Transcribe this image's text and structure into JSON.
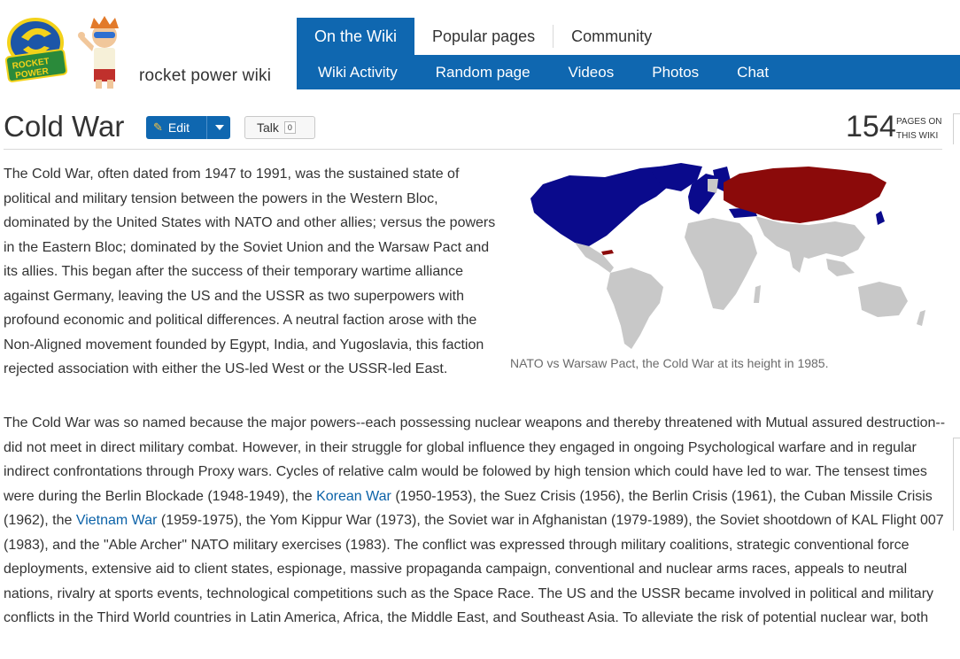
{
  "header": {
    "logo_text": "ROCKET POWER",
    "wiki_name": "rocket power wiki"
  },
  "nav": {
    "top_tabs": [
      {
        "label": "On the Wiki"
      },
      {
        "label": "Popular pages"
      },
      {
        "label": "Community"
      }
    ],
    "sub_items": [
      "Wiki Activity",
      "Random page",
      "Videos",
      "Photos",
      "Chat"
    ]
  },
  "page": {
    "title": "Cold War",
    "edit_label": "Edit",
    "talk_label": "Talk",
    "talk_count": "0",
    "pages_count": "154",
    "pages_label_1": "PAGES ON",
    "pages_label_2": "THIS WIKI"
  },
  "map": {
    "caption": "NATO vs Warsaw Pact, the Cold War at its height in 1985.",
    "colors": {
      "nato": "#0a0a8c",
      "warsaw": "#8b0a0a",
      "neutral": "#c8c8c8"
    }
  },
  "article": {
    "p1": "The Cold War, often dated from 1947 to 1991, was the sustained state of political and military tension between the powers in the Western Bloc, dominated by the United States with NATO and other allies; versus the powers in the Eastern Bloc; dominated by the Soviet Union and the Warsaw Pact and its allies. This began after the success of their temporary wartime alliance against Germany, leaving the US and the USSR as two superpowers with profound economic and political differences. A neutral faction arose with the Non-Aligned movement founded by Egypt, India, and Yugoslavia, this faction rejected association with either the US-led West or the USSR-led East.",
    "p2_a": "The Cold War was so named because the major powers--each possessing nuclear weapons and thereby threatened with Mutual assured destruction--did not meet in direct military combat. However, in their struggle for global influence they engaged in ongoing Psychological warfare and in regular indirect confrontations through Proxy wars. Cycles of relative calm would be folowed by high tension which could have led to war. The tensest times were during the Berlin Blockade (1948-1949), the ",
    "link_korean": "Korean War",
    "p2_b": " (1950-1953), the Suez Crisis (1956), the Berlin Crisis (1961), the Cuban Missile Crisis (1962), the ",
    "link_vietnam": "Vietnam War",
    "p2_c": " (1959-1975), the Yom Kippur War (1973), the Soviet war in Afghanistan (1979-1989), the Soviet shootdown of KAL Flight 007 (1983), and the \"Able Archer\" NATO military exercises (1983). The conflict was expressed through military coalitions, strategic conventional force deployments, extensive aid to client states, espionage, massive propaganda campaign, conventional and nuclear arms races, appeals to neutral nations, rivalry at sports events, technological competitions such as the Space Race. The US and the USSR became involved in political and military conflicts in the Third World countries in Latin America, Africa, the Middle East, and Southeast Asia. To alleviate the risk of potential nuclear war, both"
  }
}
